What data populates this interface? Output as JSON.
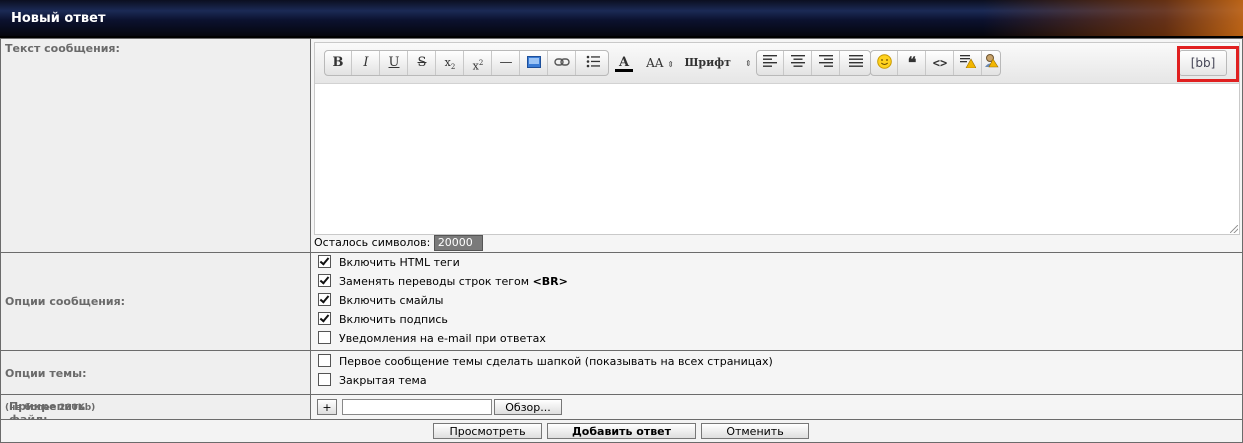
{
  "header": {
    "title": "Новый ответ"
  },
  "message": {
    "label": "Текст сообщения:",
    "remaining_label": "Осталось символов:",
    "remaining_value": "20000",
    "toolbar": {
      "font_size_label": "AA",
      "font_label": "Шрифт",
      "bb_label": "[bb]",
      "icons": [
        "bold-icon",
        "italic-icon",
        "underline-icon",
        "strikethrough-icon",
        "subscript-icon",
        "superscript-icon",
        "horizontal-rule-icon",
        "image-icon",
        "link-icon",
        "bullet-list-icon",
        "font-color-icon",
        "font-size-icon",
        "font-family-icon",
        "align-left-icon",
        "align-center-icon",
        "align-right-icon",
        "align-justify-icon",
        "smiley-icon",
        "quote-icon",
        "code-icon",
        "spoiler-icon",
        "offtop-icon"
      ]
    }
  },
  "message_options": {
    "label": "Опции сообщения:",
    "items": [
      {
        "label": "Включить HTML теги",
        "checked": true
      },
      {
        "label": "Заменять переводы строк тегом",
        "extra": "<BR>",
        "checked": true
      },
      {
        "label": "Включить смайлы",
        "checked": true
      },
      {
        "label": "Включить подпись",
        "checked": true
      },
      {
        "label": "Уведомления на e-mail при ответах",
        "checked": false
      }
    ]
  },
  "topic_options": {
    "label": "Опции темы:",
    "items": [
      {
        "label": "Первое сообщение темы сделать шапкой (показывать на всех страницах)",
        "checked": false
      },
      {
        "label": "Закрытая тема",
        "checked": false
      }
    ]
  },
  "attach": {
    "label": "Прикрепить файл:",
    "note": "(не более 200Kb)",
    "add_label": "+",
    "browse_label": "Обзор..."
  },
  "actions": {
    "preview_label": "Просмотреть",
    "submit_label": "Добавить ответ",
    "cancel_label": "Отменить"
  },
  "colors": {
    "highlight": "#e02020",
    "header": "#0c1230"
  }
}
